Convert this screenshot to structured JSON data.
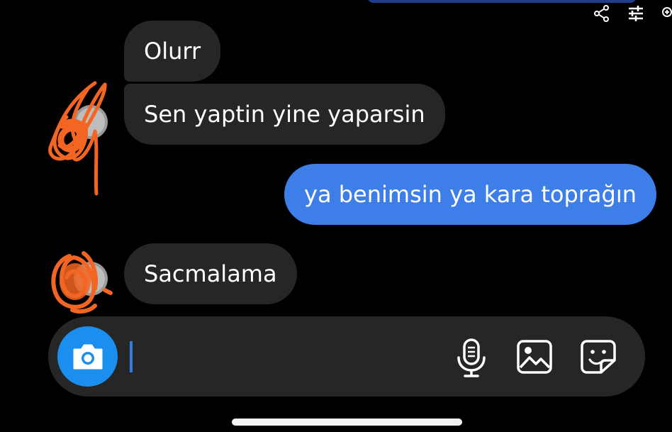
{
  "header": {
    "icons": [
      "share-icon",
      "adjust-icon",
      "zoom-icon"
    ]
  },
  "messages": [
    {
      "direction": "incoming",
      "text": "Olurr"
    },
    {
      "direction": "incoming",
      "text": "Sen yaptin yine yaparsin"
    },
    {
      "direction": "outgoing",
      "text": "ya benimsin ya kara toprağın"
    },
    {
      "direction": "incoming",
      "text": "Sacmalama"
    }
  ],
  "composer": {
    "value": "",
    "icons": [
      "camera-icon",
      "microphone-icon",
      "gallery-icon",
      "sticker-icon"
    ]
  },
  "colors": {
    "background": "#000000",
    "incoming_bubble": "#262626",
    "outgoing_bubble": "#3d7ee8",
    "accent": "#1a8ff0",
    "scribble": "#f26522"
  }
}
